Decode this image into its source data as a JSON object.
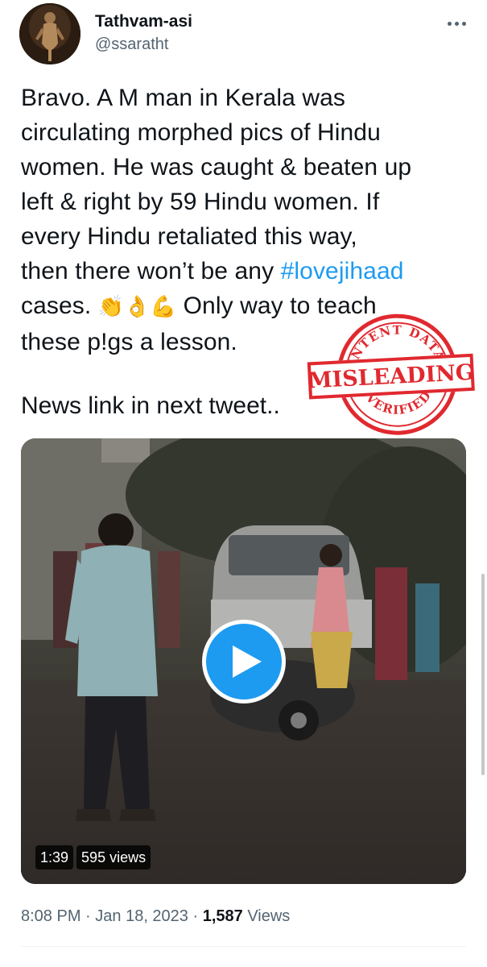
{
  "author": {
    "display_name": "Tathvam-asi",
    "handle": "@ssaratht"
  },
  "tweet": {
    "lines": [
      "Bravo. A M man in Kerala was",
      "circulating morphed pics of Hindu",
      "women. He was caught & beaten up",
      "left & right by 59 Hindu women. If",
      "every Hindu retaliated this way,",
      "then there won’t be any ",
      "these p!gs a lesson."
    ],
    "hashtag": "#lovejihaad",
    "cases_text": "cases. ",
    "emojis": "👏👌💪",
    "after_emoji_text": " Only way to teach",
    "news_line": "News link in next tweet.."
  },
  "stamp": {
    "top_text": "INTENT DATA",
    "label": "MISLEADING",
    "bottom_text": "VERIFIED",
    "color": "#e0292f"
  },
  "video": {
    "duration": "1:39",
    "views_label": "595 views"
  },
  "meta": {
    "time": "8:08 PM",
    "separator": " · ",
    "date": "Jan 18, 2023",
    "view_count": "1,587",
    "views_word": " Views"
  },
  "colors": {
    "accent": "#1d9bf0",
    "text": "#0f1419",
    "secondary": "#536471"
  }
}
